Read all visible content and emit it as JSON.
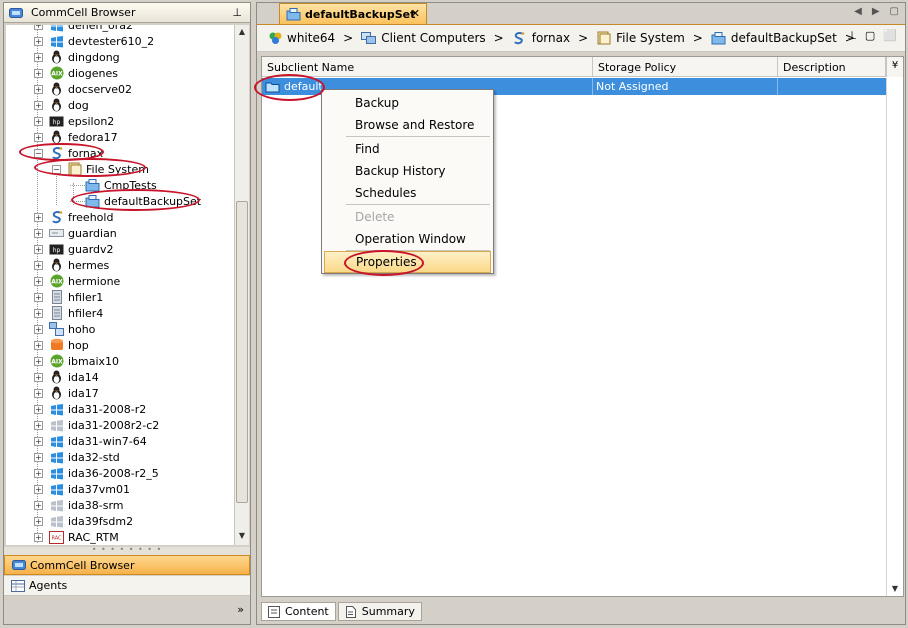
{
  "left_panel": {
    "title": "CommCell Browser",
    "pin_icon": "pin-icon",
    "tree_items": [
      {
        "label": "denen_ora2",
        "icon": "windows-icon"
      },
      {
        "label": "devtester610_2",
        "icon": "windows-icon"
      },
      {
        "label": "dingdong",
        "icon": "linux-penguin-icon"
      },
      {
        "label": "diogenes",
        "icon": "aix-icon"
      },
      {
        "label": "docserve02",
        "icon": "linux-penguin-icon"
      },
      {
        "label": "dog",
        "icon": "linux-penguin-icon"
      },
      {
        "label": "epsilon2",
        "icon": "hp-ux-icon"
      },
      {
        "label": "fedora17",
        "icon": "linux-penguin-icon"
      },
      {
        "label": "fornax",
        "icon": "solaris-icon"
      },
      {
        "label": "File System",
        "icon": "file-system-icon"
      },
      {
        "label": "CmpTests",
        "icon": "backupset-icon"
      },
      {
        "label": "defaultBackupSet",
        "icon": "backupset-icon"
      },
      {
        "label": "freehold",
        "icon": "solaris-icon"
      },
      {
        "label": "guardian",
        "icon": "server-icon"
      },
      {
        "label": "guardv2",
        "icon": "hp-ux-icon"
      },
      {
        "label": "hermes",
        "icon": "linux-penguin-icon"
      },
      {
        "label": "hermione",
        "icon": "aix-icon"
      },
      {
        "label": "hfiler1",
        "icon": "filer-icon"
      },
      {
        "label": "hfiler4",
        "icon": "filer-icon"
      },
      {
        "label": "hoho",
        "icon": "cluster-icon"
      },
      {
        "label": "hop",
        "icon": "database-icon"
      },
      {
        "label": "ibmaix10",
        "icon": "aix-icon"
      },
      {
        "label": "ida14",
        "icon": "linux-penguin-icon"
      },
      {
        "label": "ida17",
        "icon": "linux-penguin-icon"
      },
      {
        "label": "ida31-2008-r2",
        "icon": "windows-icon"
      },
      {
        "label": "ida31-2008r2-c2",
        "icon": "windows-gray-icon"
      },
      {
        "label": "ida31-win7-64",
        "icon": "windows-icon"
      },
      {
        "label": "ida32-std",
        "icon": "windows-icon"
      },
      {
        "label": "ida36-2008-r2_5",
        "icon": "windows-icon"
      },
      {
        "label": "ida37vm01",
        "icon": "windows-icon"
      },
      {
        "label": "ida38-srm",
        "icon": "windows-gray-icon"
      },
      {
        "label": "ida39fsdm2",
        "icon": "windows-gray-icon"
      },
      {
        "label": "RAC_RTM",
        "icon": "rac-icon"
      }
    ],
    "nav_buttons": [
      {
        "label": "CommCell Browser",
        "icon": "commcell-icon"
      },
      {
        "label": "Agents",
        "icon": "agents-icon"
      }
    ]
  },
  "right_panel": {
    "tab_title": "defaultBackupSet",
    "tab_close": "✕",
    "breadcrumb": [
      {
        "label": "white64",
        "icon": "commcell-icon"
      },
      {
        "label": "Client Computers",
        "icon": "computers-icon"
      },
      {
        "label": "fornax",
        "icon": "solaris-icon"
      },
      {
        "label": "File System",
        "icon": "file-system-icon"
      },
      {
        "label": "defaultBackupSet",
        "icon": "backupset-icon"
      }
    ],
    "breadcrumb_separator": ">",
    "table": {
      "columns": [
        "Subclient Name",
        "Storage Policy",
        "Description"
      ],
      "rows": [
        {
          "name": "default",
          "storage_policy": "Not Assigned",
          "description": ""
        }
      ]
    },
    "bottom_tabs": [
      {
        "label": "Content",
        "icon": "content-icon"
      },
      {
        "label": "Summary",
        "icon": "summary-icon"
      }
    ]
  },
  "context_menu": {
    "items": [
      "Backup",
      "Browse and Restore",
      "Find",
      "Backup History",
      "Schedules",
      "Delete",
      "Operation Window",
      "Properties"
    ],
    "disabled": [
      "Delete"
    ],
    "highlighted": "Properties"
  },
  "colors": {
    "selection_blue": "#3d8fde",
    "tab_orange": "#fbc25c",
    "annotation_red": "#c8142b"
  }
}
